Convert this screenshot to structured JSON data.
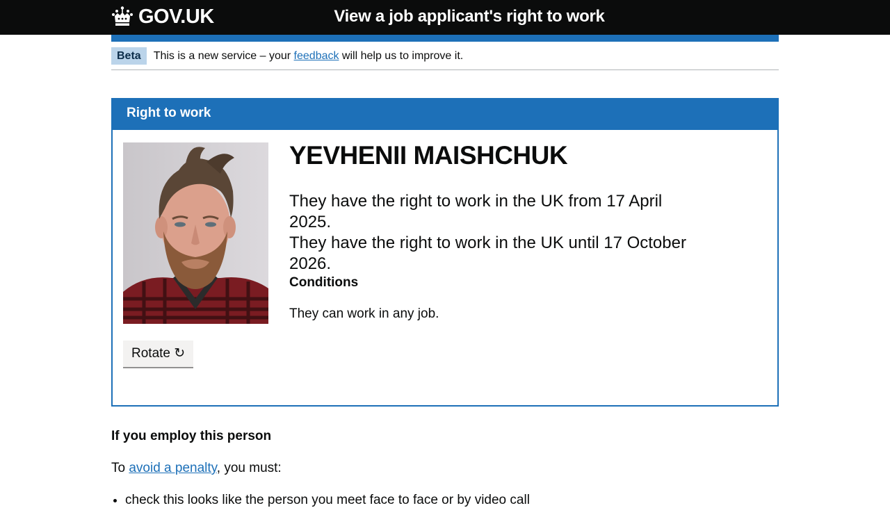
{
  "header": {
    "logo_text": "GOV.UK",
    "service_name": "View a job applicant's right to work"
  },
  "phase_banner": {
    "tag": "Beta",
    "text_before": "This is a new service – your ",
    "link": "feedback",
    "text_after": " will help us to improve it."
  },
  "panel": {
    "title": "Right to work",
    "name": "YEVHENII MAISHCHUK",
    "status_lines": [
      "They have the right to work in the UK from 17 April 2025.",
      "They have the right to work in the UK until 17 October 2026."
    ],
    "conditions_heading": "Conditions",
    "conditions_text": "They can work in any job.",
    "rotate_label": "Rotate ↻"
  },
  "employ": {
    "heading": "If you employ this person",
    "intro_before": "To ",
    "intro_link": "avoid a penalty",
    "intro_after": ", you must:",
    "bullets": [
      "check this looks like the person you meet face to face or by video call"
    ]
  },
  "colors": {
    "header_bg": "#0b0c0c",
    "brand_blue": "#1d70b8",
    "tag_bg": "#bbd4ea",
    "link": "#1d70b8"
  },
  "icons": [
    "crown-icon",
    "rotate-icon"
  ]
}
